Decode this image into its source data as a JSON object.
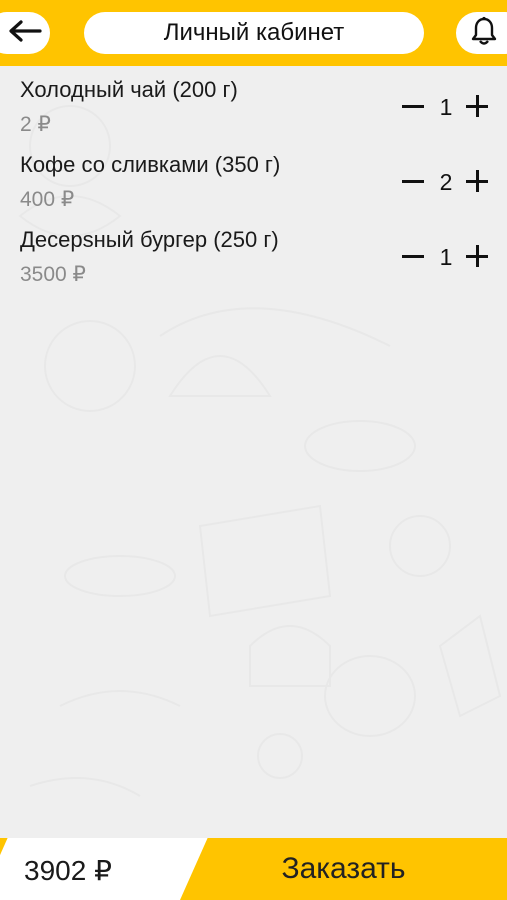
{
  "header": {
    "title": "Личный кабинет",
    "back_icon": "arrow-left-icon",
    "bell_icon": "bell-icon"
  },
  "cart": {
    "items": [
      {
        "name": "Холодный чай (200 г)",
        "price": "2 ₽",
        "qty": "1"
      },
      {
        "name": "Кофе со сливками (350 г)",
        "price": "400 ₽",
        "qty": "2"
      },
      {
        "name": "Десерsный бургер (250 г)",
        "price": "3500 ₽",
        "qty": "1"
      }
    ]
  },
  "footer": {
    "total": "3902 ₽",
    "order_label": "Заказать"
  },
  "colors": {
    "accent": "#ffc400",
    "background": "#efefef",
    "price_text": "#8a8a8a"
  }
}
